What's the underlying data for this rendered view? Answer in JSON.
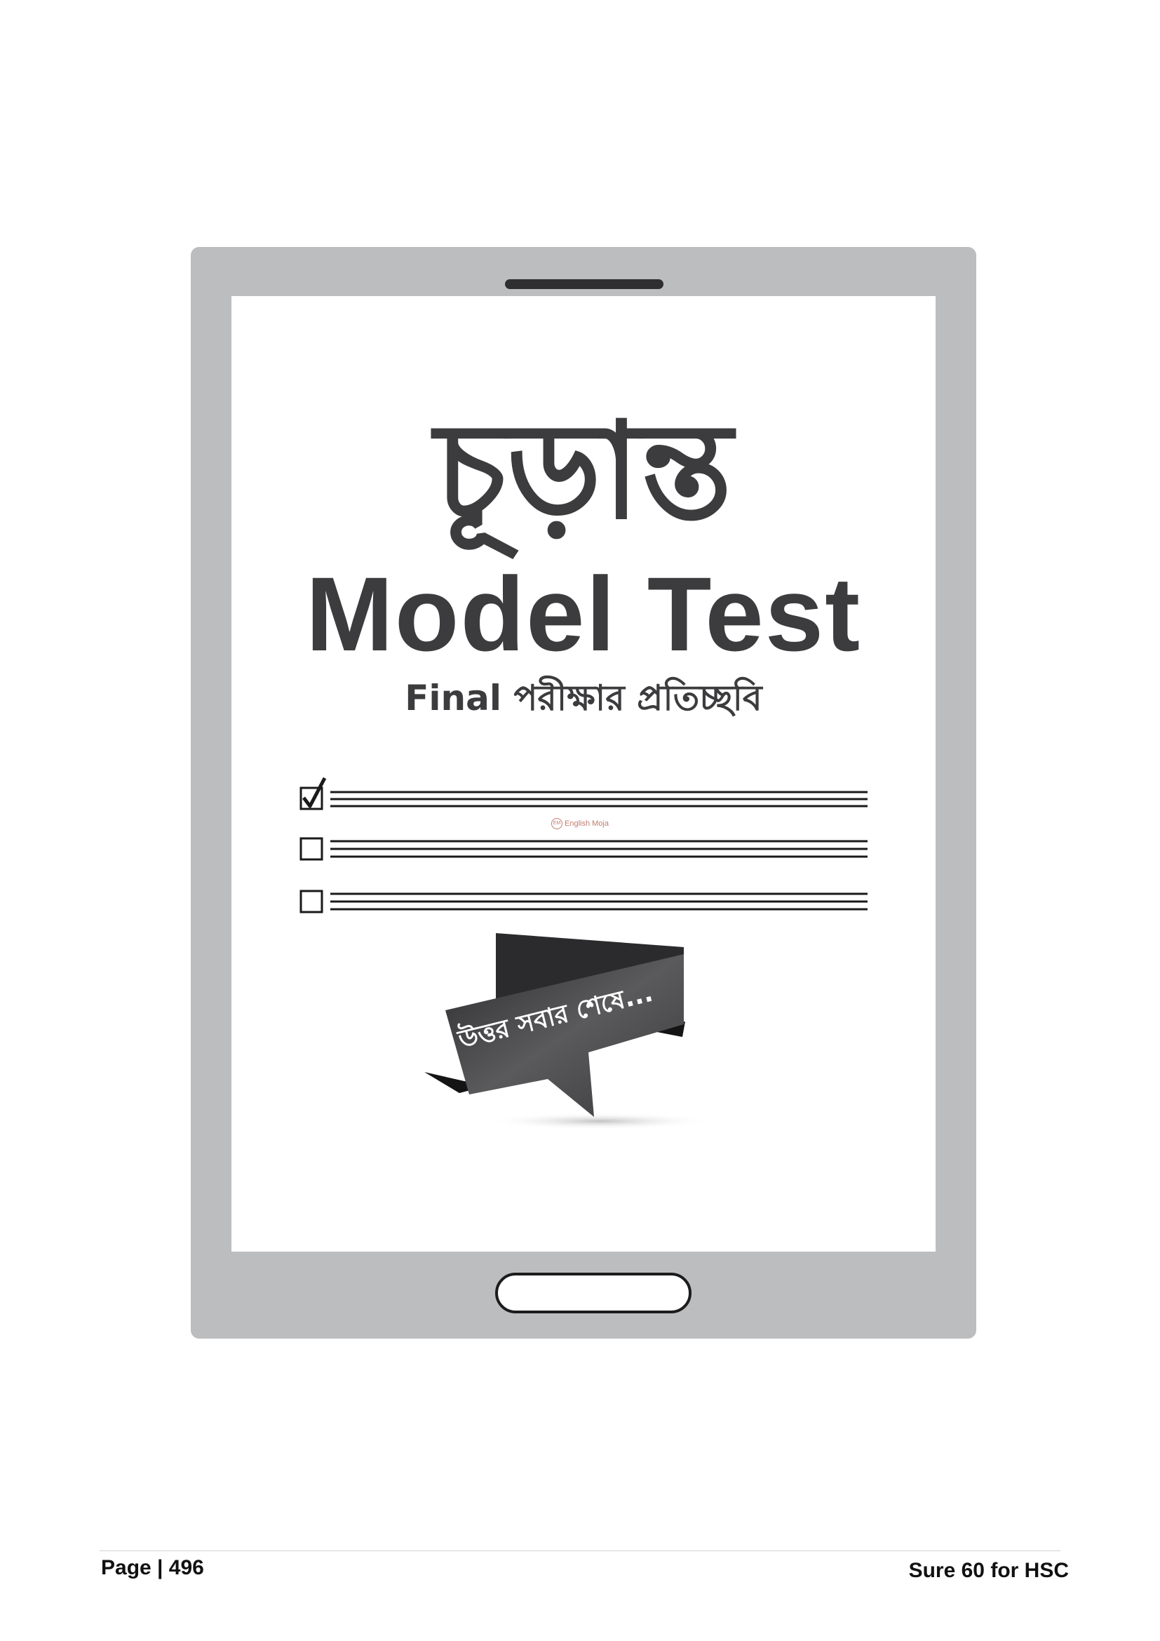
{
  "card": {
    "title_bn": "চূড়ান্ত",
    "title_en": "Model Test",
    "subtitle": "Final পরীক্ষার প্রতিচ্ছবি"
  },
  "checklist": {
    "items": [
      {
        "checked": true
      },
      {
        "checked": false
      },
      {
        "checked": false
      }
    ]
  },
  "watermark": {
    "logo_text": "EM",
    "text": "English Moja"
  },
  "ribbon": {
    "text": "উত্তর সবার শেষে..."
  },
  "footer": {
    "page_label": "Page | 496",
    "book_title": "Sure 60 for HSC"
  },
  "colors": {
    "tablet_frame": "#bcbdbf",
    "title_text": "#3c3c3e",
    "ribbon": "#4a4a4c"
  }
}
